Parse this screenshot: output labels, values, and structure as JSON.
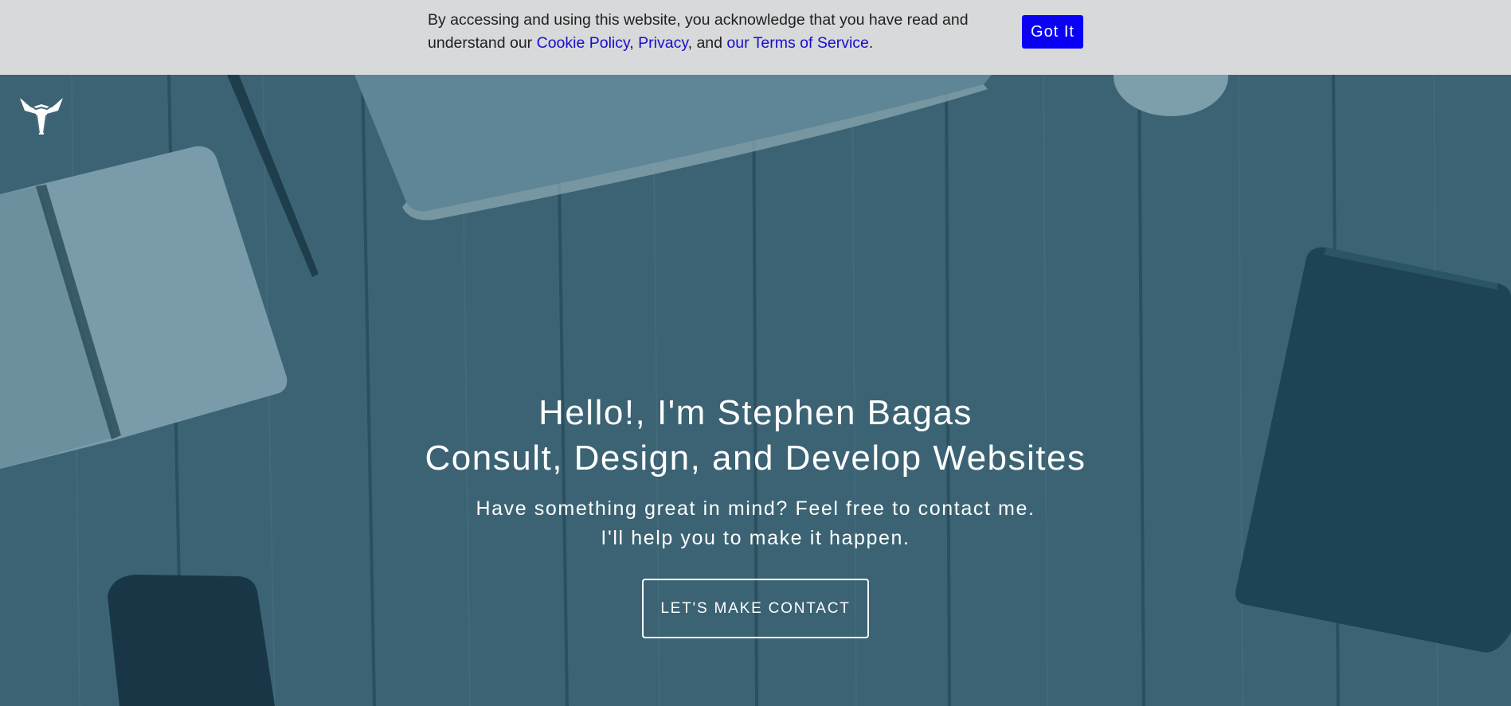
{
  "cookie_banner": {
    "text_line1": "By accessing and using this website, you acknowledge that you have read and understand our ",
    "cookie_policy_link": "Cookie Policy",
    "sep1": ", ",
    "privacy_link": "Privacy",
    "sep2": ", and ",
    "terms_link": "our Terms of Service",
    "end": ".",
    "button_label": "Got It",
    "button_color": "#0a00f5",
    "link_color": "#1a0dcc"
  },
  "header": {
    "logo_icon": "brand-logo-icon"
  },
  "hero": {
    "title_line1": "Hello!, I'm Stephen Bagas",
    "title_line2": "Consult, Design, and Develop Websites",
    "subtitle_line1": "Have something great in mind? Feel free to contact me.",
    "subtitle_line2": "I'll help you to make it happen.",
    "cta_label": "LET'S MAKE CONTACT",
    "overlay_color": "#3e6474"
  }
}
